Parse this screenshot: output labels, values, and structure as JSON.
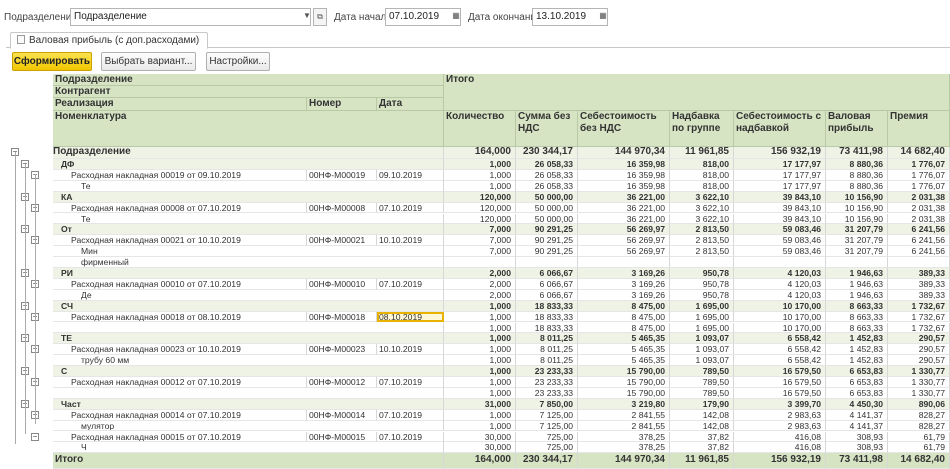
{
  "filters": {
    "dept_label": "Подразделение:",
    "dept_value": "Подразделение",
    "start_label": "Дата начала:",
    "start_value": "07.10.2019",
    "end_label": "Дата окончания:",
    "end_value": "13.10.2019"
  },
  "tab": {
    "label": "Валовая прибыль (с доп.расходами)"
  },
  "toolbar": {
    "generate": "Сформировать",
    "variant": "Выбрать вариант...",
    "settings": "Настройки..."
  },
  "header": {
    "l1": "Подразделение",
    "l2": "Контрагент",
    "l3": "Реализация",
    "num": "Номер",
    "date": "Дата",
    "l4": "Номенклатура",
    "total": "Итого",
    "cols": [
      "Количество",
      "Сумма без НДС",
      "Себестоимость без НДС",
      "Надбавка по группе",
      "Себестоимость с надбавкой",
      "Валовая прибыль",
      "Премия"
    ]
  },
  "groups": [
    {
      "level": "dept",
      "label": "Подразделение",
      "values": [
        "164,000",
        "230 344,17",
        "144 970,34",
        "11 961,85",
        "156 932,19",
        "73 411,98",
        "14 682,40"
      ]
    },
    {
      "level": "cp",
      "label": "ДФ",
      "values": [
        "1,000",
        "26 058,33",
        "16 359,98",
        "818,00",
        "17 177,97",
        "8 880,36",
        "1 776,07"
      ]
    },
    {
      "level": "doc",
      "label": "Расходная накладная 00019 от 09.10.2019",
      "num": "00НФ-М00019",
      "date": "09.10.2019",
      "values": [
        "1,000",
        "26 058,33",
        "16 359,98",
        "818,00",
        "17 177,97",
        "8 880,36",
        "1 776,07"
      ]
    },
    {
      "level": "item",
      "label": "Те",
      "values": [
        "1,000",
        "26 058,33",
        "16 359,98",
        "818,00",
        "17 177,97",
        "8 880,36",
        "1 776,07"
      ]
    },
    {
      "level": "cp",
      "label": "КА",
      "values": [
        "120,000",
        "50 000,00",
        "36 221,00",
        "3 622,10",
        "39 843,10",
        "10 156,90",
        "2 031,38"
      ]
    },
    {
      "level": "doc",
      "label": "Расходная накладная 00008 от 07.10.2019",
      "num": "00НФ-М00008",
      "date": "07.10.2019",
      "values": [
        "120,000",
        "50 000,00",
        "36 221,00",
        "3 622,10",
        "39 843,10",
        "10 156,90",
        "2 031,38"
      ]
    },
    {
      "level": "item",
      "label": "Те",
      "values": [
        "120,000",
        "50 000,00",
        "36 221,00",
        "3 622,10",
        "39 843,10",
        "10 156,90",
        "2 031,38"
      ]
    },
    {
      "level": "cp",
      "label": "От",
      "values": [
        "7,000",
        "90 291,25",
        "56 269,97",
        "2 813,50",
        "59 083,46",
        "31 207,79",
        "6 241,56"
      ]
    },
    {
      "level": "doc",
      "label": "Расходная накладная 00021 от 10.10.2019",
      "num": "00НФ-М00021",
      "date": "10.10.2019",
      "values": [
        "7,000",
        "90 291,25",
        "56 269,97",
        "2 813,50",
        "59 083,46",
        "31 207,79",
        "6 241,56"
      ]
    },
    {
      "level": "item",
      "label": "Мин",
      "values": [
        "7,000",
        "90 291,25",
        "56 269,97",
        "2 813,50",
        "59 083,46",
        "31 207,79",
        "6 241,56"
      ]
    },
    {
      "level": "item2",
      "label": "фирменный ",
      "values": [
        "",
        "",
        "",
        "",
        "",
        "",
        ""
      ]
    },
    {
      "level": "cp",
      "label": "РИ",
      "values": [
        "2,000",
        "6 066,67",
        "3 169,26",
        "950,78",
        "4 120,03",
        "1 946,63",
        "389,33"
      ]
    },
    {
      "level": "doc",
      "label": "Расходная накладная 00010 от 07.10.2019",
      "num": "00НФ-М00010",
      "date": "07.10.2019",
      "values": [
        "2,000",
        "6 066,67",
        "3 169,26",
        "950,78",
        "4 120,03",
        "1 946,63",
        "389,33"
      ]
    },
    {
      "level": "item",
      "label": "Де",
      "values": [
        "2,000",
        "6 066,67",
        "3 169,26",
        "950,78",
        "4 120,03",
        "1 946,63",
        "389,33"
      ]
    },
    {
      "level": "cp",
      "label": "СЧ",
      "values": [
        "1,000",
        "18 833,33",
        "8 475,00",
        "1 695,00",
        "10 170,00",
        "8 663,33",
        "1 732,67"
      ]
    },
    {
      "level": "doc",
      "label": "Расходная накладная 00018 от 08.10.2019",
      "num": "00НФ-М00018",
      "date": "08.10.2019",
      "sel": true,
      "values": [
        "1,000",
        "18 833,33",
        "8 475,00",
        "1 695,00",
        "10 170,00",
        "8 663,33",
        "1 732,67"
      ]
    },
    {
      "level": "item",
      "label": "",
      "values": [
        "1,000",
        "18 833,33",
        "8 475,00",
        "1 695,00",
        "10 170,00",
        "8 663,33",
        "1 732,67"
      ]
    },
    {
      "level": "cp",
      "label": "ТЕ",
      "values": [
        "1,000",
        "8 011,25",
        "5 465,35",
        "1 093,07",
        "6 558,42",
        "1 452,83",
        "290,57"
      ]
    },
    {
      "level": "doc",
      "label": "Расходная накладная 00023 от 10.10.2019",
      "num": "00НФ-М00023",
      "date": "10.10.2019",
      "values": [
        "1,000",
        "8 011,25",
        "5 465,35",
        "1 093,07",
        "6 558,42",
        "1 452,83",
        "290,57"
      ]
    },
    {
      "level": "item",
      "label": "трубу 60 мм",
      "values": [
        "1,000",
        "8 011,25",
        "5 465,35",
        "1 093,07",
        "6 558,42",
        "1 452,83",
        "290,57"
      ]
    },
    {
      "level": "cp",
      "label": "С",
      "values": [
        "1,000",
        "23 233,33",
        "15 790,00",
        "789,50",
        "16 579,50",
        "6 653,83",
        "1 330,77"
      ]
    },
    {
      "level": "doc",
      "label": "Расходная накладная 00012 от 07.10.2019",
      "num": "00НФ-М00012",
      "date": "07.10.2019",
      "values": [
        "1,000",
        "23 233,33",
        "15 790,00",
        "789,50",
        "16 579,50",
        "6 653,83",
        "1 330,77"
      ]
    },
    {
      "level": "item",
      "label": "",
      "values": [
        "1,000",
        "23 233,33",
        "15 790,00",
        "789,50",
        "16 579,50",
        "6 653,83",
        "1 330,77"
      ]
    },
    {
      "level": "cp",
      "label": "Част",
      "values": [
        "31,000",
        "7 850,00",
        "3 219,80",
        "179,90",
        "3 399,70",
        "4 450,30",
        "890,06"
      ]
    },
    {
      "level": "doc",
      "label": "Расходная накладная 00014 от 07.10.2019",
      "num": "00НФ-М00014",
      "date": "07.10.2019",
      "values": [
        "1,000",
        "7 125,00",
        "2 841,55",
        "142,08",
        "2 983,63",
        "4 141,37",
        "828,27"
      ]
    },
    {
      "level": "item",
      "label": "мулятор",
      "values": [
        "1,000",
        "7 125,00",
        "2 841,55",
        "142,08",
        "2 983,63",
        "4 141,37",
        "828,27"
      ]
    },
    {
      "level": "doc",
      "label": "Расходная накладная 00015 от 07.10.2019",
      "num": "00НФ-М00015",
      "date": "07.10.2019",
      "values": [
        "30,000",
        "725,00",
        "378,25",
        "37,82",
        "416,08",
        "308,93",
        "61,79"
      ]
    },
    {
      "level": "item",
      "label": "Ч",
      "values": [
        "30,000",
        "725,00",
        "378,25",
        "37,82",
        "416,08",
        "308,93",
        "61,79"
      ]
    }
  ],
  "total": {
    "label": "Итого",
    "values": [
      "164,000",
      "230 344,17",
      "144 970,34",
      "11 961,85",
      "156 932,19",
      "73 411,98",
      "14 682,40"
    ]
  }
}
